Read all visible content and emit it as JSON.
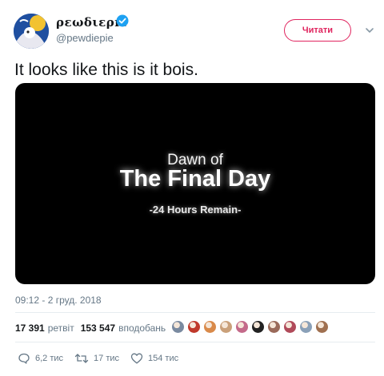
{
  "author": {
    "display_name": "ρεωδιερıε",
    "handle": "@pewdiepie",
    "verified": true
  },
  "follow_button": {
    "label": "Читати"
  },
  "tweet": {
    "text": "It looks like this is it bois.",
    "timestamp": "09:12 - 2 груд. 2018"
  },
  "media": {
    "line1": "Dawn of",
    "line2": "The Final Day",
    "line3": "-24 Hours Remain-"
  },
  "stats": {
    "retweets_count": "17 391",
    "retweets_label": "ретвіт",
    "likes_count": "153 547",
    "likes_label": "вподобань"
  },
  "likers": {
    "colors": [
      "#7a8aa0",
      "#c0392b",
      "#d98a4a",
      "#caa07a",
      "#c46a8a",
      "#222222",
      "#9a6a5a",
      "#b04a5a",
      "#8aa0b8",
      "#a07050"
    ]
  },
  "actions": {
    "replies": "6,2 тис",
    "retweets": "17 тис",
    "likes": "154 тис"
  },
  "colors": {
    "accent": "#e0245e",
    "verified": "#1da1f2",
    "muted": "#657786"
  }
}
